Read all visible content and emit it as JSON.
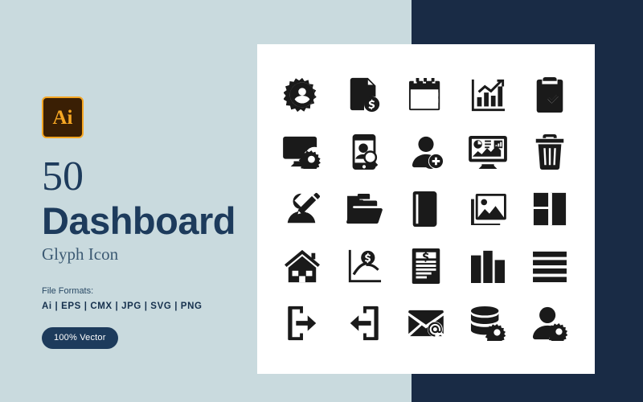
{
  "colors": {
    "left_bg": "#c9dade",
    "right_bg": "#192b45",
    "card_bg": "#ffffff",
    "heading": "#1d3b5c",
    "icon": "#1a1a1a",
    "badge_bg": "#3a1f04",
    "badge_border": "#f5a623",
    "badge_text": "#f5a623",
    "pill_bg": "#1d3b5c",
    "pill_text": "#ffffff"
  },
  "left": {
    "badge_text": "Ai",
    "count": "50",
    "title": "Dashboard",
    "subtitle": "Glyph Icon",
    "formats_label": "File Formats:",
    "formats_list": "Ai  |  EPS  |  CMX  |  JPG  |  SVG  |  PNG",
    "vector_pill": "100% Vector"
  },
  "icons": [
    {
      "name": "user-settings-gear-icon"
    },
    {
      "name": "invoice-dollar-document-icon"
    },
    {
      "name": "calendar-icon"
    },
    {
      "name": "bar-chart-growth-icon"
    },
    {
      "name": "clipboard-check-icon"
    },
    {
      "name": "monitor-settings-icon"
    },
    {
      "name": "mobile-user-search-icon"
    },
    {
      "name": "add-user-icon"
    },
    {
      "name": "analytics-dashboard-monitor-icon"
    },
    {
      "name": "trash-bin-icon"
    },
    {
      "name": "user-edit-pencil-icon"
    },
    {
      "name": "open-folder-icon"
    },
    {
      "name": "closed-folder-icon"
    },
    {
      "name": "image-gallery-icon"
    },
    {
      "name": "layout-grid-panels-icon"
    },
    {
      "name": "home-house-icon"
    },
    {
      "name": "dollar-line-chart-icon"
    },
    {
      "name": "financial-report-document-icon"
    },
    {
      "name": "column-layout-chart-icon"
    },
    {
      "name": "list-menu-lines-icon"
    },
    {
      "name": "login-arrow-icon"
    },
    {
      "name": "logout-arrow-icon"
    },
    {
      "name": "email-at-envelope-icon"
    },
    {
      "name": "database-server-settings-icon"
    },
    {
      "name": "user-account-settings-icon"
    }
  ]
}
